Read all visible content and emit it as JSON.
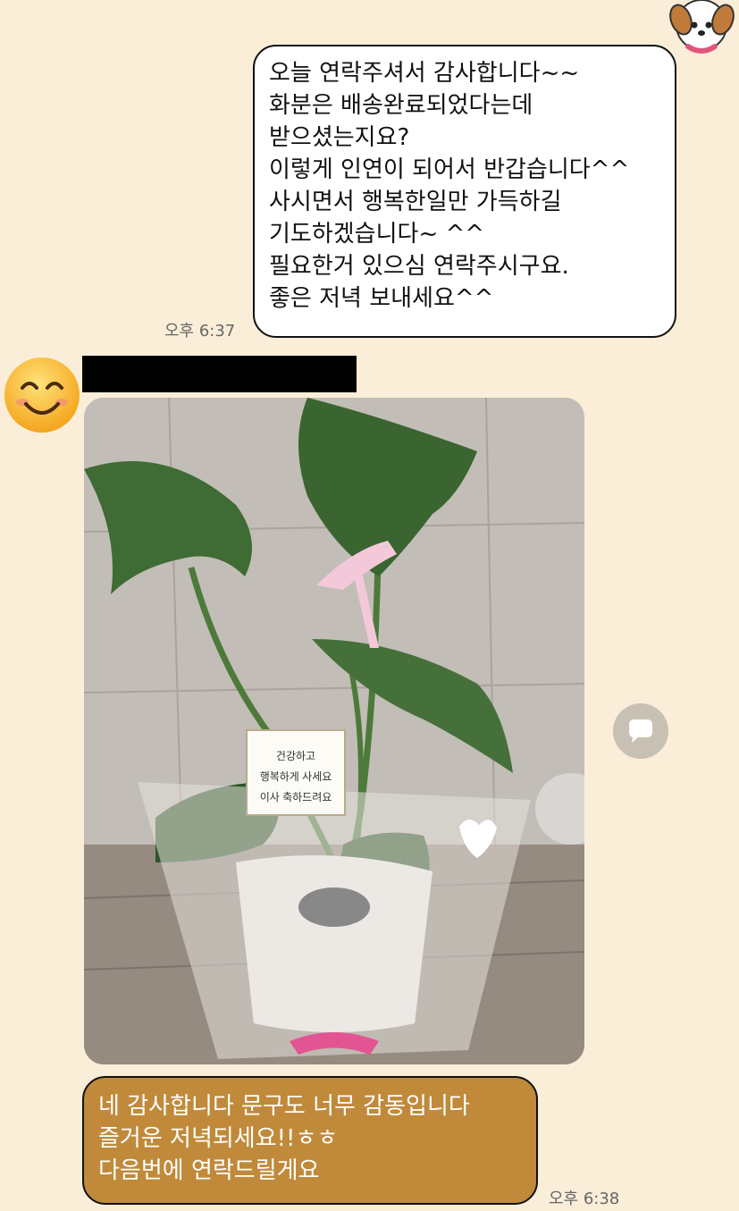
{
  "sent_message": {
    "text": "오늘 연락주셔서 감사합니다~~\n화분은 배송완료되었다는데\n받으셨는지요?\n이렇게 인연이 되어서 반갑습니다^^\n사시면서 행복한일만 가득하길\n기도하겠습니다~ ^^\n필요한거 있으심 연락주시구요.\n좋은 저녁 보내세요^^",
    "time": "오후 6:37"
  },
  "received_message": {
    "text": "네 감사합니다 문구도 너무 감동입니다\n즐거운 저녁되세요!!ㅎㅎ\n다음번에 연락드릴게요",
    "time": "오후 6:38"
  },
  "photo": {
    "card_text": "건강하고\n행복하게 사세요\n이사 축하드려요"
  },
  "icons": {
    "my_avatar": "dog-avatar-icon",
    "sender_avatar": "smiley-face-icon",
    "share": "speech-bubble-icon"
  },
  "colors": {
    "background": "#fbeed9",
    "sent_bubble": "#ffffff",
    "received_bubble": "#c08a3a"
  }
}
